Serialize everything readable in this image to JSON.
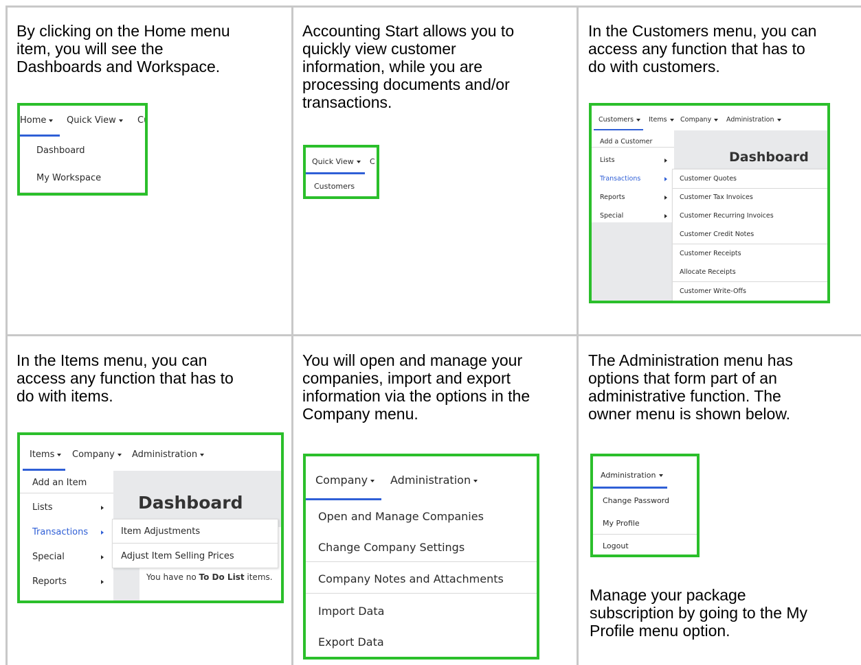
{
  "cells": {
    "home": {
      "text": [
        "By clicking on the Home menu",
        "item, you will see the",
        "Dashboards and Workspace."
      ],
      "nav": [
        "Home",
        "Quick View",
        "Cu"
      ],
      "items": [
        "Dashboard",
        "My Workspace"
      ]
    },
    "quickview": {
      "text": [
        "Accounting Start allows you to",
        "quickly view customer",
        "information, while you are",
        "processing documents and/or",
        "transactions."
      ],
      "nav": [
        "Quick View",
        "C"
      ],
      "items": [
        "Customers"
      ]
    },
    "customers": {
      "text": [
        "In the Customers menu, you can",
        "access any function that has to",
        "do with customers."
      ],
      "nav": [
        "Customers",
        "Items",
        "Company",
        "Administration"
      ],
      "items": [
        "Add a Customer",
        "Lists",
        "Transactions",
        "Reports",
        "Special"
      ],
      "dashboard": "Dashboard",
      "submenu": [
        "Customer Quotes",
        "Customer Tax Invoices",
        "Customer Recurring Invoices",
        "Customer Credit Notes",
        "Customer Receipts",
        "Allocate Receipts",
        "Customer Write-Offs"
      ]
    },
    "items": {
      "text": [
        "In the Items menu, you can",
        "access any function that has to",
        "do with items."
      ],
      "nav": [
        "Items",
        "Company",
        "Administration"
      ],
      "items": [
        "Add an Item",
        "Lists",
        "Transactions",
        "Special",
        "Reports"
      ],
      "dashboard": "Dashboard",
      "submenu": [
        "Item Adjustments",
        "Adjust Item Selling Prices"
      ],
      "todo_prefix": "You have no ",
      "todo_bold": "To Do List",
      "todo_suffix": " items."
    },
    "company": {
      "text": [
        "You will open and manage your",
        "companies, import and export",
        "information via the options in the",
        "Company menu."
      ],
      "nav": [
        "Company",
        "Administration"
      ],
      "items": [
        "Open and Manage Companies",
        "Change Company Settings",
        "Company Notes and Attachments",
        "Import Data",
        "Export Data"
      ]
    },
    "admin": {
      "text": [
        "The Administration menu has",
        "options that form part of an",
        "administrative function.  The",
        "owner menu is shown below."
      ],
      "nav": [
        "Administration"
      ],
      "items": [
        "Change Password",
        "My Profile",
        "Logout"
      ],
      "footer": [
        "Manage your package",
        "subscription by going to the My",
        "Profile menu option."
      ]
    }
  },
  "colors": {
    "highlight": "#2bbf2b",
    "accent": "#2f5fd6",
    "grid": "#c8c8c8"
  },
  "icons": [
    "caret-down-icon",
    "chevron-right-icon"
  ]
}
